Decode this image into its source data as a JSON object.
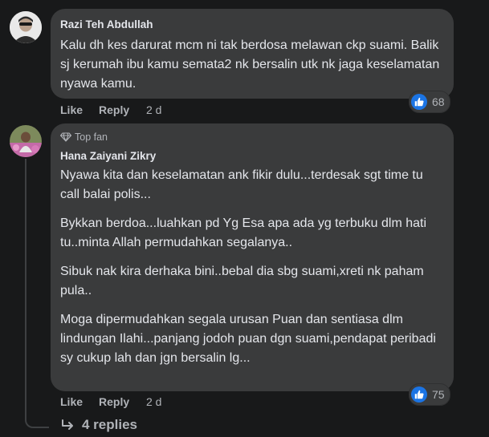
{
  "comments": [
    {
      "author": "Razi Teh Abdullah",
      "paragraphs": [
        "Kalu dh kes darurat mcm ni tak berdosa melawan ckp suami. Balik sj kerumah ibu kamu semata2 nk bersalin utk nk jaga keselamatan nyawa kamu."
      ],
      "like_label": "Like",
      "reply_label": "Reply",
      "time": "2 d",
      "reaction_icon": "like-icon",
      "reaction_count": "68"
    },
    {
      "badge": "Top fan",
      "badge_icon": "diamond-icon",
      "author": "Hana Zaiyani Zikry",
      "paragraphs": [
        "Nyawa kita dan keselamatan ank fikir dulu...terdesak sgt time tu call balai polis...",
        "Bykkan berdoa...luahkan pd Yg Esa apa ada yg terbuku dlm hati tu..minta Allah permudahkan segalanya..",
        "Sibuk nak kira derhaka bini..bebal dia sbg suami,xreti nk paham pula..",
        "Moga dipermudahkan segala urusan Puan dan sentiasa dlm lindungan Ilahi...panjang jodoh puan dgn suami,pendapat peribadi sy cukup lah dan jgn bersalin lg..."
      ],
      "like_label": "Like",
      "reply_label": "Reply",
      "time": "2 d",
      "reaction_icon": "like-icon",
      "reaction_count": "75"
    }
  ],
  "view_replies": {
    "icon": "reply-arrow-icon",
    "label": "4 replies"
  },
  "colors": {
    "background": "#18191a",
    "bubble": "#3a3b3c",
    "text": "#e4e6eb",
    "secondary_text": "#b0b3b8",
    "like_blue": "#1b74e4"
  }
}
